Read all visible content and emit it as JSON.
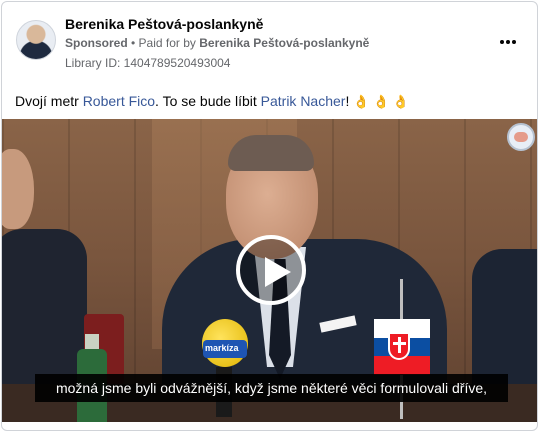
{
  "post": {
    "page_name": "Berenika Peštová-poslankyně",
    "sponsored_label": "Sponsored",
    "paid_for_prefix": " • Paid for by ",
    "paid_for_name": "Berenika Peštová-poslankyně",
    "library_id": "Library ID: 1404789520493004",
    "more_icon": "more-horizontal-icon",
    "text_part1": "Dvojí metr ",
    "mention1": "Robert Fico",
    "text_part2": ". To se bude líbit ",
    "mention2": "Patrik Nacher",
    "text_part3": "! ",
    "emoji": "👌 👌 👌"
  },
  "video": {
    "subtitle": "možná jsme byli odvážnější, když jsme některé věci formulovali dříve,",
    "mic_brand": "markíza",
    "play_icon": "play-icon",
    "channel_icon": "channel-logo-icon"
  },
  "colors": {
    "link": "#385898",
    "meta": "#65676b",
    "text": "#050505"
  }
}
